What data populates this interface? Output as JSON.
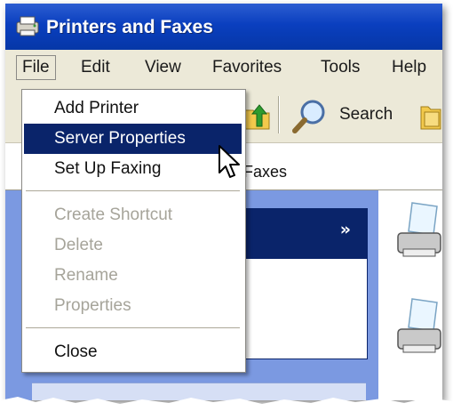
{
  "window": {
    "title": "Printers and Faxes",
    "title_icon": "printers-folder-icon",
    "colors": {
      "titlebar": "#0a3fbf",
      "highlight": "#0a246a",
      "chrome": "#ece9d8"
    }
  },
  "menubar": {
    "items": [
      {
        "label": "File",
        "active": true
      },
      {
        "label": "Edit"
      },
      {
        "label": "View"
      },
      {
        "label": "Favorites"
      },
      {
        "label": "Tools"
      },
      {
        "label": "Help"
      }
    ]
  },
  "file_menu": {
    "items": [
      {
        "label": "Add Printer",
        "enabled": true
      },
      {
        "label": "Server Properties",
        "enabled": true,
        "highlighted": true
      },
      {
        "label": "Set Up Faxing",
        "enabled": true
      },
      {
        "label": "Create Shortcut",
        "enabled": false
      },
      {
        "label": "Delete",
        "enabled": false
      },
      {
        "label": "Rename",
        "enabled": false
      },
      {
        "label": "Properties",
        "enabled": false
      },
      {
        "label": "Close",
        "enabled": true
      }
    ]
  },
  "toolbar": {
    "search_label": "Search",
    "icons": [
      "up-folder-icon",
      "search-icon",
      "folders-icon"
    ]
  },
  "address": {
    "text": "Faxes"
  },
  "taskpane": {
    "chevron": "»"
  },
  "content": {
    "icons": [
      "printer-icon",
      "printer-icon"
    ]
  }
}
